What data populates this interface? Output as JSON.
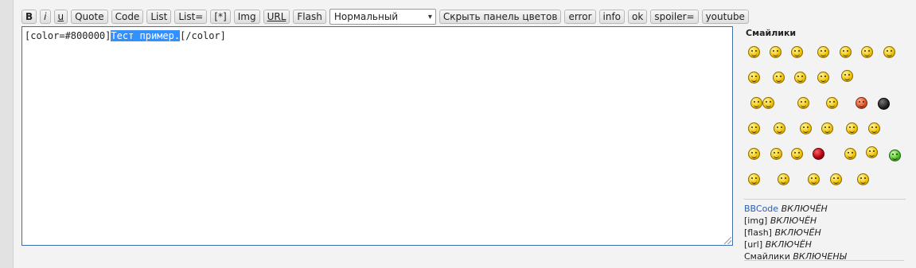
{
  "toolbar": {
    "buttons": [
      "B",
      "i",
      "u",
      "Quote",
      "Code",
      "List",
      "List=",
      "[*]",
      "Img",
      "URL",
      "Flash"
    ],
    "font_size_select": "Нормальный",
    "buttons_after": [
      "Скрыть панель цветов",
      "error",
      "info",
      "ok",
      "spoiler=",
      "youtube"
    ]
  },
  "editor": {
    "text_before": "[color=#800000]",
    "text_selected": "Тест пример.",
    "text_after": "[/color]"
  },
  "sidebar": {
    "smilies_title": "Смайлики",
    "bbcode_label": "BBCode",
    "bbcode_state": "ВКЛЮЧЁН",
    "img_label": "[img]",
    "img_state": "ВКЛЮЧЁН",
    "flash_label": "[flash]",
    "flash_state": "ВКЛЮЧЁН",
    "url_label": "[url]",
    "url_state": "ВКЛЮЧЁН",
    "smilies_label": "Смайлики",
    "smilies_state": "ВКЛЮЧЕНЫ"
  }
}
